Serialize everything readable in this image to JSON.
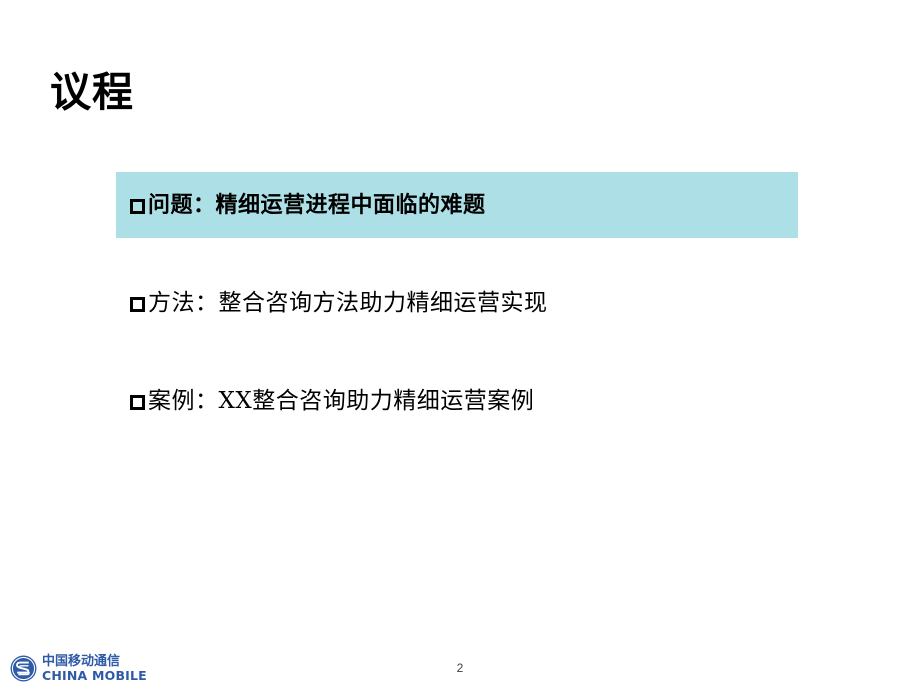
{
  "slide": {
    "title": "议程",
    "page_number": "2",
    "background_color": "#ffffff",
    "highlight_color": "#addfe6",
    "brand_color": "#2f5aa8"
  },
  "agenda": {
    "items": [
      {
        "bullet": "square-outline-bullet",
        "label": "问题：精细运营进程中面临的难题",
        "highlighted": true
      },
      {
        "bullet": "square-outline-bullet",
        "label": "方法：整合咨询方法助力精细运营实现",
        "highlighted": false
      },
      {
        "bullet": "square-outline-bullet",
        "label": "案例：XX整合咨询助力精细运营案例",
        "highlighted": false
      }
    ]
  },
  "footer": {
    "logo_icon": "china-mobile-logo-icon",
    "logo_text_cn": "中国移动通信",
    "logo_text_en": "CHINA MOBILE"
  }
}
